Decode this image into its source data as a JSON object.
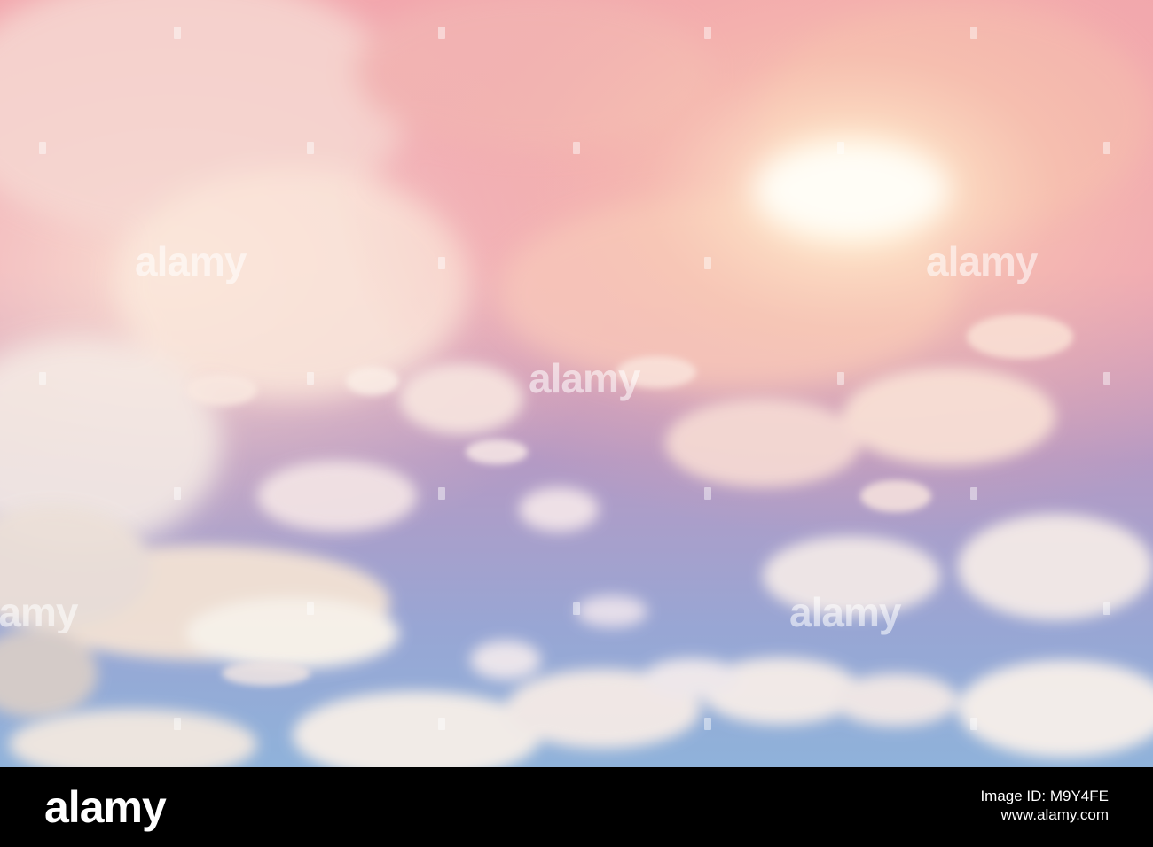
{
  "image": {
    "subject": "sky-with-clouds",
    "colors": {
      "top_pink": "#f0a0a8",
      "sun_glow": "#fff3d6",
      "mid_purple": "#a89ac6",
      "bottom_blue": "#8fb0da",
      "cloud_cream": "#fbeee2"
    }
  },
  "watermarks": {
    "text": "alamy"
  },
  "footer": {
    "logo": "alamy",
    "image_id_label": "Image ID: M9Y4FE",
    "url": "www.alamy.com"
  }
}
